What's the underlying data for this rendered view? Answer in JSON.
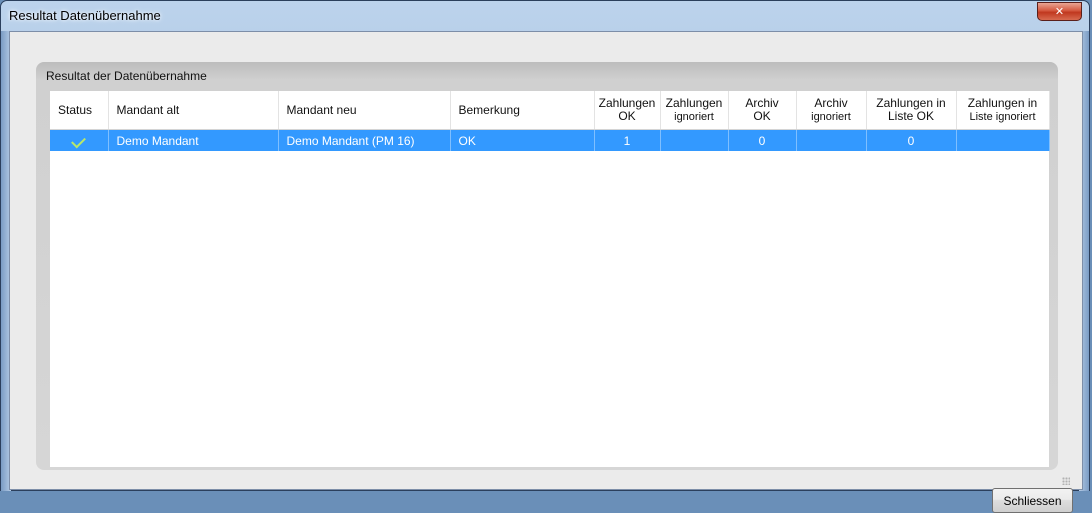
{
  "window": {
    "title": "Resultat Datenübernahme",
    "close_glyph": "✕",
    "accent_color": "#3399ff"
  },
  "group": {
    "title": "Resultat der Datenübernahme"
  },
  "table": {
    "columns": [
      {
        "line1": "Status",
        "line2": ""
      },
      {
        "line1": "Mandant alt",
        "line2": ""
      },
      {
        "line1": "Mandant neu",
        "line2": ""
      },
      {
        "line1": "Bemerkung",
        "line2": ""
      },
      {
        "line1": "Zahlungen",
        "line2": "OK"
      },
      {
        "line1": "Zahlungen",
        "line2": "ignoriert"
      },
      {
        "line1": "Archiv",
        "line2": "OK"
      },
      {
        "line1": "Archiv",
        "line2": "ignoriert"
      },
      {
        "line1": "Zahlungen in",
        "line2": "Liste OK"
      },
      {
        "line1": "Zahlungen in",
        "line2": "Liste ignoriert"
      }
    ],
    "rows": [
      {
        "status_icon": "check-icon",
        "mandant_alt": "Demo Mandant",
        "mandant_neu": "Demo Mandant (PM 16)",
        "bemerkung": "OK",
        "zahlungen_ok": "1",
        "zahlungen_ignoriert": "",
        "archiv_ok": "0",
        "archiv_ignoriert": "",
        "liste_ok": "0",
        "liste_ignoriert": ""
      }
    ]
  },
  "buttons": {
    "close_label": "Schliessen"
  }
}
